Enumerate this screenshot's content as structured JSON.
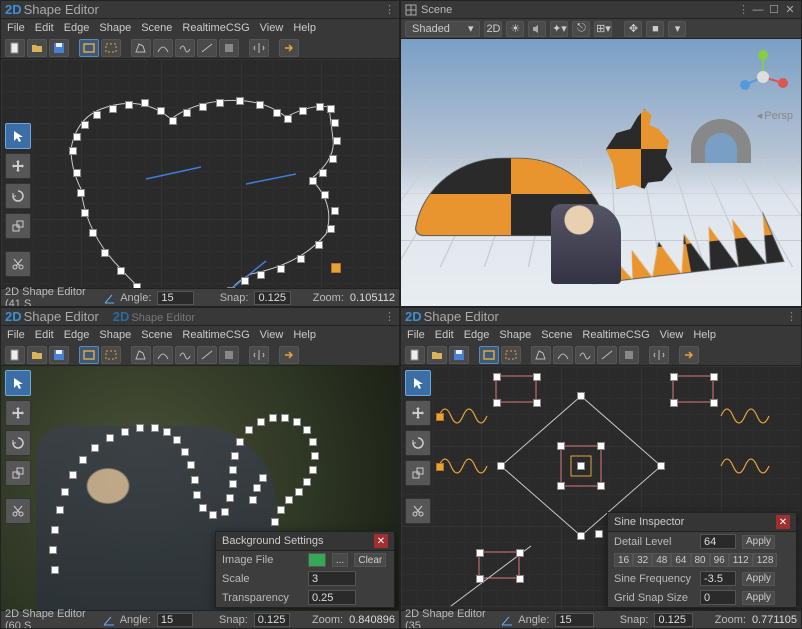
{
  "menus": [
    "File",
    "Edit",
    "Edge",
    "Shape",
    "Scene",
    "RealtimeCSG",
    "View",
    "Help"
  ],
  "panels": {
    "topLeft": {
      "title": "Shape Editor",
      "status": {
        "title": "2D Shape Editor (41 S",
        "angleLabel": "Angle:",
        "angle": "15",
        "snapLabel": "Snap:",
        "snap": "0.125",
        "zoomLabel": "Zoom:",
        "zoom": "0.105112"
      }
    },
    "bottomLeft": {
      "title": "Shape Editor",
      "tabInactive": "Shape Editor",
      "status": {
        "title": "2D Shape Editor (60 S",
        "angleLabel": "Angle:",
        "angle": "15",
        "snapLabel": "Snap:",
        "snap": "0.125",
        "zoomLabel": "Zoom:",
        "zoom": "0.840896"
      },
      "popup": {
        "title": "Background Settings",
        "rows": [
          {
            "label": "Image File",
            "buttons": [
              "...",
              "Clear"
            ]
          },
          {
            "label": "Scale",
            "value": "3"
          },
          {
            "label": "Transparency",
            "value": "0.25"
          }
        ]
      }
    },
    "bottomRight": {
      "title": "Shape Editor",
      "status": {
        "title": "2D Shape Editor (35",
        "angleLabel": "Angle:",
        "angle": "15",
        "snapLabel": "Snap:",
        "snap": "0.125",
        "zoomLabel": "Zoom:",
        "zoom": "0.771105"
      },
      "popup": {
        "title": "Sine Inspector",
        "detailLabel": "Detail Level",
        "detailValue": "64",
        "apply": "Apply",
        "presets": [
          "16",
          "32",
          "48",
          "64",
          "80",
          "96",
          "112",
          "128"
        ],
        "freqLabel": "Sine Frequency",
        "freqValue": "-3.5",
        "gridLabel": "Grid Snap Size",
        "gridValue": "0"
      }
    }
  },
  "scene": {
    "tab": "Scene",
    "shading": "Shaded",
    "mode2d": "2D",
    "persp": "Persp"
  },
  "toolbar_icons": [
    "new",
    "open",
    "save",
    "sep",
    "rect",
    "rect-sel",
    "sep",
    "poly",
    "arc",
    "free",
    "line",
    "fill",
    "sep",
    "flip",
    "sep",
    "export"
  ],
  "side_tools": [
    "pointer",
    "move",
    "rotate",
    "scale",
    "cut"
  ]
}
